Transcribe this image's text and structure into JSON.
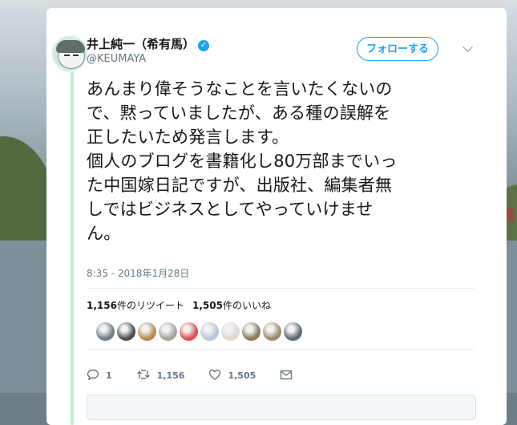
{
  "tweet": {
    "author_name": "井上純一（希有馬）",
    "handle": "@KEUMAYA",
    "follow_label": "フォローする",
    "text_lines": [
      "あんまり偉そうなことを言いたくないの",
      "で、黙っていましたが、ある種の誤解を",
      "正したいため発言します。",
      "個人のブログを書籍化し80万部までいっ",
      "た中国嫁日記ですが、出版社、編集者無",
      "しではビジネスとしてやっていけませ",
      "ん。"
    ],
    "timestamp": "8:35 - 2018年1月28日",
    "retweet_count": "1,156",
    "retweet_suffix": "件のリツイート",
    "like_count": "1,505",
    "like_suffix": "件のいいね",
    "reply_count": "1",
    "retweet_action_count": "1,156",
    "like_action_count": "1,505"
  },
  "icons": {
    "verified": "verified-badge-icon",
    "reply": "reply-icon",
    "retweet": "retweet-icon",
    "like": "heart-icon",
    "dm": "envelope-icon",
    "more": "chevron-down-icon"
  },
  "colors": {
    "accent": "#1da1f2",
    "text": "#14171a",
    "muted": "#657786",
    "thread_line": "#c1f2cc"
  },
  "likers": [
    {
      "color": "#6f7d88"
    },
    {
      "color": "#4b4f55"
    },
    {
      "color": "#b58a55"
    },
    {
      "color": "#a7a39c"
    },
    {
      "color": "#d9544f"
    },
    {
      "color": "#b8c4d8"
    },
    {
      "color": "#e0d7d2"
    },
    {
      "color": "#8b7a5e"
    },
    {
      "color": "#9b8a6a"
    },
    {
      "color": "#5d6a73"
    }
  ]
}
